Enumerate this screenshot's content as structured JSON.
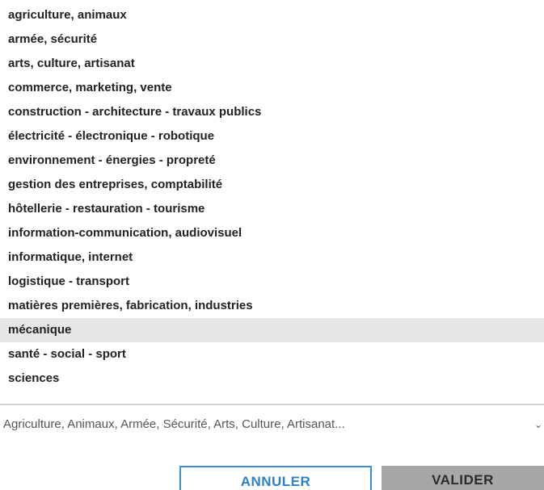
{
  "options": [
    {
      "label": "agriculture, animaux"
    },
    {
      "label": "armée, sécurité"
    },
    {
      "label": "arts, culture, artisanat"
    },
    {
      "label": "commerce, marketing, vente"
    },
    {
      "label": "construction - architecture - travaux publics"
    },
    {
      "label": "électricité - électronique - robotique"
    },
    {
      "label": "environnement - énergies - propreté"
    },
    {
      "label": "gestion des entreprises, comptabilité"
    },
    {
      "label": "hôtellerie - restauration - tourisme"
    },
    {
      "label": "information-communication, audiovisuel"
    },
    {
      "label": "informatique, internet"
    },
    {
      "label": "logistique - transport"
    },
    {
      "label": "matières premières, fabrication, industries"
    },
    {
      "label": "mécanique",
      "highlighted": true
    },
    {
      "label": "santé - social - sport"
    },
    {
      "label": "sciences"
    }
  ],
  "summary": {
    "text": "Agriculture, Animaux, Armée, Sécurité, Arts, Culture, Artisanat...",
    "icon": "chevron-down-icon"
  },
  "buttons": {
    "cancel_label": "ANNULER",
    "validate_label": "VALIDER"
  },
  "colors": {
    "highlight": "#e6e6e9",
    "cancel_border": "#3c8ed6",
    "cancel_text": "#2f7fc7",
    "validate_bg": "#a7a7a7"
  }
}
